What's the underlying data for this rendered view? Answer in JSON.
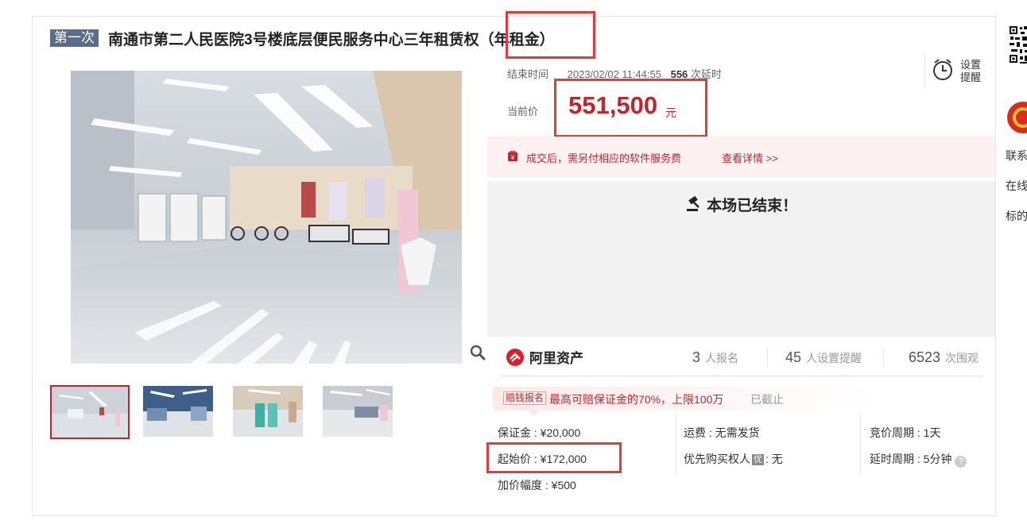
{
  "title": {
    "times_badge": "第一次",
    "text": "南通市第二人民医院3号楼底层便民服务中心三年租赁权",
    "suffix": "（年租金）"
  },
  "auction": {
    "end_label": "结束时间",
    "end_time": "2023/02/02 11:44:55",
    "delay_count": "556",
    "delay_label": "次延时",
    "remind_label": "设置提醒",
    "price_label": "当前价",
    "current_price": "551,500",
    "price_unit": "元"
  },
  "fee_notice": {
    "text": "成交后，需另付相应的软件服务费",
    "link": "查看详情 >>"
  },
  "status": {
    "ended_text": "本场已结束！"
  },
  "stats": {
    "brand": "阿里资产",
    "registered_count": "3",
    "registered_label": "人报名",
    "reminder_count": "45",
    "reminder_label": "人设置提醒",
    "views_count": "6523",
    "views_label": "次围观"
  },
  "compensation": {
    "badge": "赔钱报名",
    "text": "最高可赔保证金的70%，上限100万",
    "status": "已截止"
  },
  "details": {
    "deposit": "保证金 : ¥20,000",
    "start_price": "起始价 : ¥172,000",
    "increment": "加价幅度 : ¥500",
    "shipping": "运费 : 无需发货",
    "priority_label": "优先购买权人",
    "priority_badge": "优",
    "priority_value": ": 无",
    "bid_cycle": "竞价周期 : 1天",
    "delay_cycle": "延时周期 : 5分钟"
  },
  "right_column": {
    "line1": "联系",
    "line2": "在线",
    "line3": "标的"
  },
  "colors": {
    "accent_red": "#c2262d",
    "annotation_red": "#e53a3a",
    "badge_blue": "#5a6e8c"
  }
}
